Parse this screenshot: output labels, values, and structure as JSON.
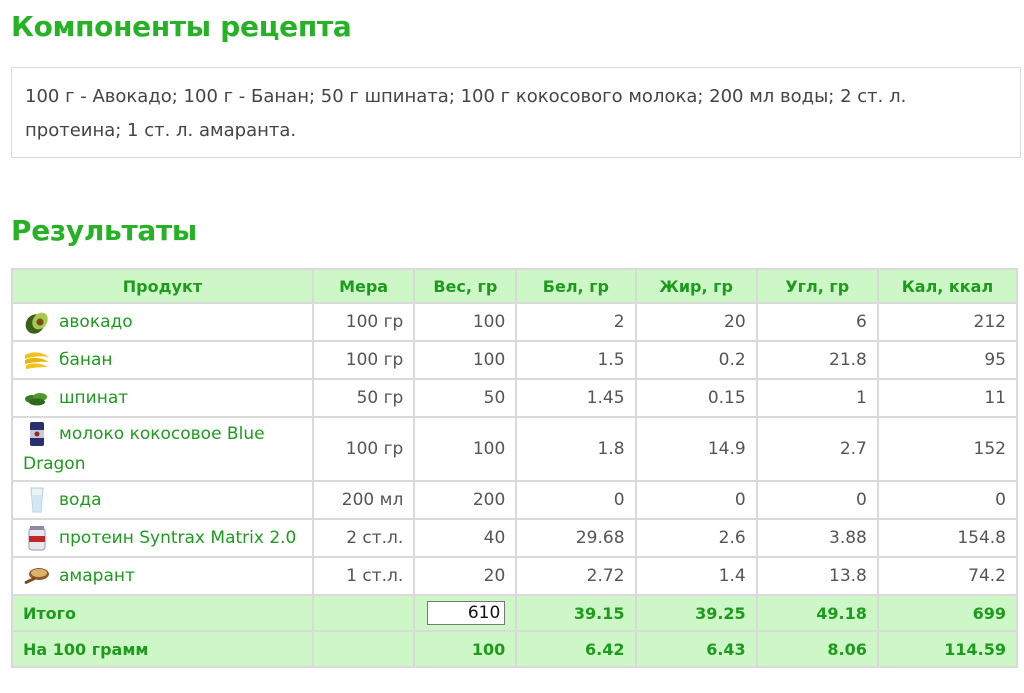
{
  "headings": {
    "components": "Компоненты рецепта",
    "results": "Результаты"
  },
  "recipe_text": "100 г - Авокадо; 100 г - Банан; 50 г шпината; 100 г кокосового молока; 200 мл воды; 2 ст. л. протеина; 1 ст. л. амаранта.",
  "table": {
    "headers": [
      "Продукт",
      "Мера",
      "Вес, гр",
      "Бел, гр",
      "Жир, гр",
      "Угл, гр",
      "Кал, ккал"
    ],
    "rows": [
      {
        "icon": "avocado-icon",
        "product": "авокадо",
        "measure": "100 гр",
        "weight": "100",
        "protein": "2",
        "fat": "20",
        "carbs": "6",
        "kcal": "212"
      },
      {
        "icon": "banana-icon",
        "product": "банан",
        "measure": "100 гр",
        "weight": "100",
        "protein": "1.5",
        "fat": "0.2",
        "carbs": "21.8",
        "kcal": "95"
      },
      {
        "icon": "spinach-icon",
        "product": "шпинат",
        "measure": "50 гр",
        "weight": "50",
        "protein": "1.45",
        "fat": "0.15",
        "carbs": "1",
        "kcal": "11"
      },
      {
        "icon": "coconut-milk-can-icon",
        "product": "молоко кокосовое Blue Dragon",
        "measure": "100 гр",
        "weight": "100",
        "protein": "1.8",
        "fat": "14.9",
        "carbs": "2.7",
        "kcal": "152"
      },
      {
        "icon": "water-glass-icon",
        "product": "вода",
        "measure": "200 мл",
        "weight": "200",
        "protein": "0",
        "fat": "0",
        "carbs": "0",
        "kcal": "0"
      },
      {
        "icon": "protein-jar-icon",
        "product": "протеин Syntrax Matrix 2.0",
        "measure": "2 ст.л.",
        "weight": "40",
        "protein": "29.68",
        "fat": "2.6",
        "carbs": "3.88",
        "kcal": "154.8"
      },
      {
        "icon": "amaranth-scoop-icon",
        "product": "амарант",
        "measure": "1 ст.л.",
        "weight": "20",
        "protein": "2.72",
        "fat": "1.4",
        "carbs": "13.8",
        "kcal": "74.2"
      }
    ],
    "total": {
      "label": "Итого",
      "weight": "610",
      "protein": "39.15",
      "fat": "39.25",
      "carbs": "49.18",
      "kcal": "699"
    },
    "per100": {
      "label": "На 100 грамм",
      "weight": "100",
      "protein": "6.42",
      "fat": "6.43",
      "carbs": "8.06",
      "kcal": "114.59"
    }
  }
}
